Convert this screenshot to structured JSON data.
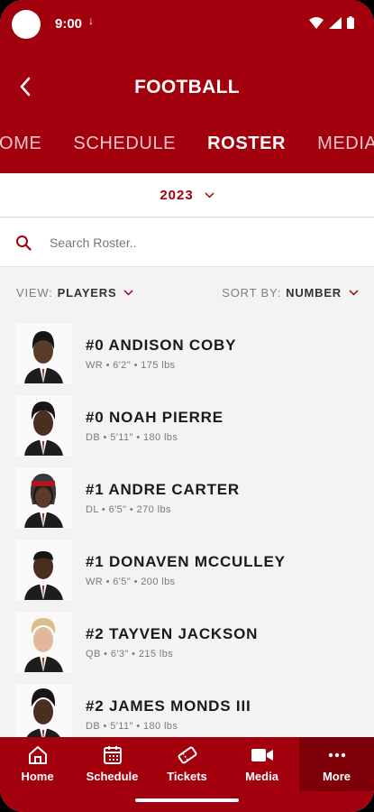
{
  "status_bar": {
    "time": "9:00",
    "download_glyph": "↓"
  },
  "header": {
    "title": "FOOTBALL",
    "back_icon": "chevron-left-icon",
    "tabs": [
      {
        "label": "HOME",
        "active": false
      },
      {
        "label": "SCHEDULE",
        "active": false
      },
      {
        "label": "ROSTER",
        "active": true
      },
      {
        "label": "MEDIA",
        "active": false
      }
    ]
  },
  "year_selector": {
    "value": "2023"
  },
  "search": {
    "placeholder": "Search Roster.."
  },
  "filters": {
    "view_label": "VIEW:",
    "view_value": "PLAYERS",
    "sort_label": "SORT BY:",
    "sort_value": "NUMBER"
  },
  "players": [
    {
      "name": "#0 ANDISON COBY",
      "meta": "WR • 6'2\" • 175 lbs"
    },
    {
      "name": "#0 NOAH PIERRE",
      "meta": "DB • 5'11\" • 180 lbs"
    },
    {
      "name": "#1 ANDRE CARTER",
      "meta": "DL • 6'5\" • 270 lbs"
    },
    {
      "name": "#1 DONAVEN MCCULLEY",
      "meta": "WR • 6'5\" • 200 lbs"
    },
    {
      "name": "#2 TAYVEN JACKSON",
      "meta": "QB • 6'3\" • 215 lbs"
    },
    {
      "name": "#2 JAMES MONDS III",
      "meta": "DB • 5'11\" • 180 lbs"
    }
  ],
  "bottom_nav": [
    {
      "label": "Home",
      "icon": "home-icon"
    },
    {
      "label": "Schedule",
      "icon": "calendar-icon"
    },
    {
      "label": "Tickets",
      "icon": "ticket-icon"
    },
    {
      "label": "Media",
      "icon": "video-camera-icon"
    },
    {
      "label": "More",
      "icon": "more-dots-icon",
      "active": true
    }
  ],
  "colors": {
    "brand": "#a3000e",
    "brand_dark": "#7d0009",
    "background": "#f3f3f3"
  }
}
